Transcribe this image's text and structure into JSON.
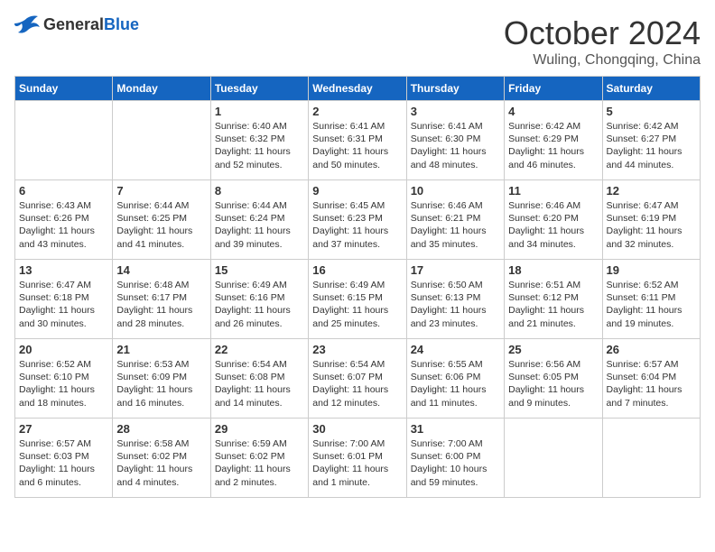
{
  "header": {
    "logo_general": "General",
    "logo_blue": "Blue",
    "title": "October 2024",
    "subtitle": "Wuling, Chongqing, China"
  },
  "days_of_week": [
    "Sunday",
    "Monday",
    "Tuesday",
    "Wednesday",
    "Thursday",
    "Friday",
    "Saturday"
  ],
  "weeks": [
    [
      {
        "day": "",
        "sunrise": "",
        "sunset": "",
        "daylight": ""
      },
      {
        "day": "",
        "sunrise": "",
        "sunset": "",
        "daylight": ""
      },
      {
        "day": "1",
        "sunrise": "Sunrise: 6:40 AM",
        "sunset": "Sunset: 6:32 PM",
        "daylight": "Daylight: 11 hours and 52 minutes."
      },
      {
        "day": "2",
        "sunrise": "Sunrise: 6:41 AM",
        "sunset": "Sunset: 6:31 PM",
        "daylight": "Daylight: 11 hours and 50 minutes."
      },
      {
        "day": "3",
        "sunrise": "Sunrise: 6:41 AM",
        "sunset": "Sunset: 6:30 PM",
        "daylight": "Daylight: 11 hours and 48 minutes."
      },
      {
        "day": "4",
        "sunrise": "Sunrise: 6:42 AM",
        "sunset": "Sunset: 6:29 PM",
        "daylight": "Daylight: 11 hours and 46 minutes."
      },
      {
        "day": "5",
        "sunrise": "Sunrise: 6:42 AM",
        "sunset": "Sunset: 6:27 PM",
        "daylight": "Daylight: 11 hours and 44 minutes."
      }
    ],
    [
      {
        "day": "6",
        "sunrise": "Sunrise: 6:43 AM",
        "sunset": "Sunset: 6:26 PM",
        "daylight": "Daylight: 11 hours and 43 minutes."
      },
      {
        "day": "7",
        "sunrise": "Sunrise: 6:44 AM",
        "sunset": "Sunset: 6:25 PM",
        "daylight": "Daylight: 11 hours and 41 minutes."
      },
      {
        "day": "8",
        "sunrise": "Sunrise: 6:44 AM",
        "sunset": "Sunset: 6:24 PM",
        "daylight": "Daylight: 11 hours and 39 minutes."
      },
      {
        "day": "9",
        "sunrise": "Sunrise: 6:45 AM",
        "sunset": "Sunset: 6:23 PM",
        "daylight": "Daylight: 11 hours and 37 minutes."
      },
      {
        "day": "10",
        "sunrise": "Sunrise: 6:46 AM",
        "sunset": "Sunset: 6:21 PM",
        "daylight": "Daylight: 11 hours and 35 minutes."
      },
      {
        "day": "11",
        "sunrise": "Sunrise: 6:46 AM",
        "sunset": "Sunset: 6:20 PM",
        "daylight": "Daylight: 11 hours and 34 minutes."
      },
      {
        "day": "12",
        "sunrise": "Sunrise: 6:47 AM",
        "sunset": "Sunset: 6:19 PM",
        "daylight": "Daylight: 11 hours and 32 minutes."
      }
    ],
    [
      {
        "day": "13",
        "sunrise": "Sunrise: 6:47 AM",
        "sunset": "Sunset: 6:18 PM",
        "daylight": "Daylight: 11 hours and 30 minutes."
      },
      {
        "day": "14",
        "sunrise": "Sunrise: 6:48 AM",
        "sunset": "Sunset: 6:17 PM",
        "daylight": "Daylight: 11 hours and 28 minutes."
      },
      {
        "day": "15",
        "sunrise": "Sunrise: 6:49 AM",
        "sunset": "Sunset: 6:16 PM",
        "daylight": "Daylight: 11 hours and 26 minutes."
      },
      {
        "day": "16",
        "sunrise": "Sunrise: 6:49 AM",
        "sunset": "Sunset: 6:15 PM",
        "daylight": "Daylight: 11 hours and 25 minutes."
      },
      {
        "day": "17",
        "sunrise": "Sunrise: 6:50 AM",
        "sunset": "Sunset: 6:13 PM",
        "daylight": "Daylight: 11 hours and 23 minutes."
      },
      {
        "day": "18",
        "sunrise": "Sunrise: 6:51 AM",
        "sunset": "Sunset: 6:12 PM",
        "daylight": "Daylight: 11 hours and 21 minutes."
      },
      {
        "day": "19",
        "sunrise": "Sunrise: 6:52 AM",
        "sunset": "Sunset: 6:11 PM",
        "daylight": "Daylight: 11 hours and 19 minutes."
      }
    ],
    [
      {
        "day": "20",
        "sunrise": "Sunrise: 6:52 AM",
        "sunset": "Sunset: 6:10 PM",
        "daylight": "Daylight: 11 hours and 18 minutes."
      },
      {
        "day": "21",
        "sunrise": "Sunrise: 6:53 AM",
        "sunset": "Sunset: 6:09 PM",
        "daylight": "Daylight: 11 hours and 16 minutes."
      },
      {
        "day": "22",
        "sunrise": "Sunrise: 6:54 AM",
        "sunset": "Sunset: 6:08 PM",
        "daylight": "Daylight: 11 hours and 14 minutes."
      },
      {
        "day": "23",
        "sunrise": "Sunrise: 6:54 AM",
        "sunset": "Sunset: 6:07 PM",
        "daylight": "Daylight: 11 hours and 12 minutes."
      },
      {
        "day": "24",
        "sunrise": "Sunrise: 6:55 AM",
        "sunset": "Sunset: 6:06 PM",
        "daylight": "Daylight: 11 hours and 11 minutes."
      },
      {
        "day": "25",
        "sunrise": "Sunrise: 6:56 AM",
        "sunset": "Sunset: 6:05 PM",
        "daylight": "Daylight: 11 hours and 9 minutes."
      },
      {
        "day": "26",
        "sunrise": "Sunrise: 6:57 AM",
        "sunset": "Sunset: 6:04 PM",
        "daylight": "Daylight: 11 hours and 7 minutes."
      }
    ],
    [
      {
        "day": "27",
        "sunrise": "Sunrise: 6:57 AM",
        "sunset": "Sunset: 6:03 PM",
        "daylight": "Daylight: 11 hours and 6 minutes."
      },
      {
        "day": "28",
        "sunrise": "Sunrise: 6:58 AM",
        "sunset": "Sunset: 6:02 PM",
        "daylight": "Daylight: 11 hours and 4 minutes."
      },
      {
        "day": "29",
        "sunrise": "Sunrise: 6:59 AM",
        "sunset": "Sunset: 6:02 PM",
        "daylight": "Daylight: 11 hours and 2 minutes."
      },
      {
        "day": "30",
        "sunrise": "Sunrise: 7:00 AM",
        "sunset": "Sunset: 6:01 PM",
        "daylight": "Daylight: 11 hours and 1 minute."
      },
      {
        "day": "31",
        "sunrise": "Sunrise: 7:00 AM",
        "sunset": "Sunset: 6:00 PM",
        "daylight": "Daylight: 10 hours and 59 minutes."
      },
      {
        "day": "",
        "sunrise": "",
        "sunset": "",
        "daylight": ""
      },
      {
        "day": "",
        "sunrise": "",
        "sunset": "",
        "daylight": ""
      }
    ]
  ]
}
